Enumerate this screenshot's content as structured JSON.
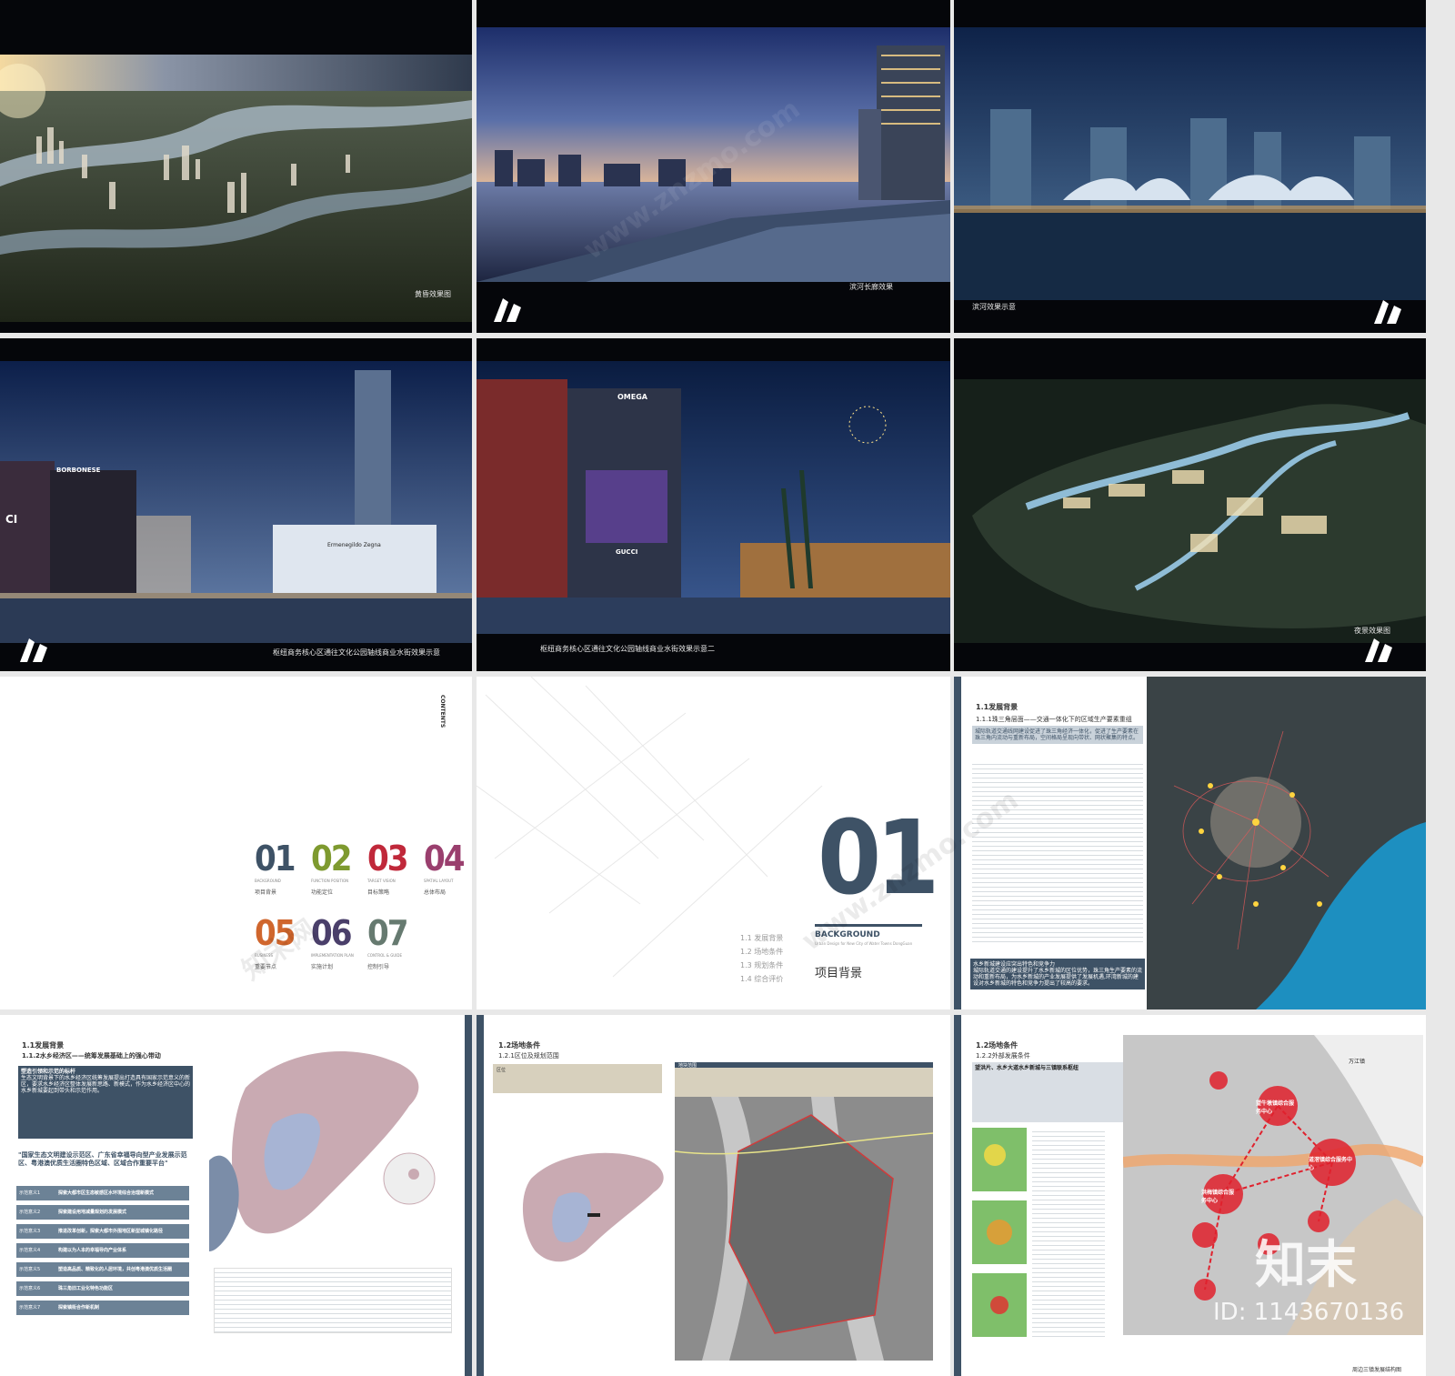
{
  "top_row": [
    {
      "caption": "黄昏效果图"
    },
    {
      "caption": "滨河长廊效果"
    },
    {
      "caption": "滨河效果示意"
    }
  ],
  "mid_row": [
    {
      "caption": "枢纽商务核心区通往文化公园轴线商业水街效果示意"
    },
    {
      "caption": "枢纽商务核心区通往文化公园轴线商业水街效果示意二"
    },
    {
      "caption": "夜景效果图"
    }
  ],
  "signs": {
    "borbonese": "BORBONESE",
    "ci": "CI",
    "zegna": "Ermenegildo Zegna",
    "omega": "OMEGA",
    "gucci": "GUCCI"
  },
  "contents": {
    "vertical_label": "CONTENTS",
    "items": [
      {
        "num": "01",
        "en": "BACKGROUND",
        "cn": "项目背景",
        "color": "#3e5266"
      },
      {
        "num": "02",
        "en": "FUNCTION POSITION",
        "cn": "功能定位",
        "color": "#7e9a2f"
      },
      {
        "num": "03",
        "en": "TARGET VISION",
        "cn": "目标策略",
        "color": "#c0283a"
      },
      {
        "num": "04",
        "en": "SPATIAL LAYOUT",
        "cn": "总体布局",
        "color": "#9a3f6e"
      },
      {
        "num": "05",
        "en": "BUSINESS",
        "cn": "重要节点",
        "color": "#d0662d"
      },
      {
        "num": "06",
        "en": "IMPLEMENTATION PLAN",
        "cn": "实施计划",
        "color": "#4a3f6a"
      },
      {
        "num": "07",
        "en": "CONTROL & GUIDE",
        "cn": "控制引导",
        "color": "#667a70"
      }
    ]
  },
  "chapter": {
    "num": "01",
    "en": "BACKGROUND",
    "en_sub": "Urban Design for New City of Water Towns DongGuan",
    "cn": "项目背景",
    "list": [
      "1.1 发展背景",
      "1.2 场地条件",
      "1.3 规划条件",
      "1.4 综合评价"
    ]
  },
  "page_11": {
    "title": "1.1发展背景",
    "subtitle": "1.1.1珠三角层面——交通一体化下的区域生产要素重组",
    "highlight": "城际轨道交通线网建设促进了珠三角经济一体化，促进了生产要素在珠三角内流动与重新布局，空间格局呈现向带状、网状聚集的特点。",
    "bottom_box": "水乡新城建设应突出特色和竞争力\n城际轨道交通的建设提升了水乡新城的区位优势，珠三角生产要素的流动和重新布局，为水乡新城的产业发展提供了发展机遇,环湾新城的建设对水乡新城的特色和竞争力提出了较高的要求。"
  },
  "page_112": {
    "title": "1.1发展背景",
    "subtitle": "1.1.2水乡经济区——统筹发展基础上的强心带动",
    "box_title": "塑造引领和示范的标杆",
    "box_text": "生态文明背景下的水乡经济区统筹发展提出打造具有国家示范意义的新区，要求水乡经济区整体发展新思路、新模式，作为水乡经济区中心的水乡新城要起到带头和示范作用。",
    "quote": "\"国家生态文明建设示范区、广东省幸福导向型产业发展示范区、粤港澳优质生活圈特色区域、区域合作重要平台\"",
    "rows": [
      {
        "tag": "示范意义1",
        "text": "探索大都市区生态敏感区水环境综合治理新模式"
      },
      {
        "tag": "示范意义2",
        "text": "探索建设用地减量规划的发展模式"
      },
      {
        "tag": "示范意义3",
        "text": "推进改革创新，探索大都市外围地区新型城镇化路径"
      },
      {
        "tag": "示范意义4",
        "text": "构建以为人本的幸福导向产业体系"
      },
      {
        "tag": "示范意义5",
        "text": "塑造高品质、精致化的人居环境，共创粤港澳优质生活圈"
      },
      {
        "tag": "示范意义6",
        "text": "珠三角旧工业化特色功能区"
      },
      {
        "tag": "示范意义7",
        "text": "探索镇街合作新机制"
      }
    ]
  },
  "page_121": {
    "title": "1.2场地条件",
    "subtitle": "1.2.1区位及规划范围",
    "tab": "地块范围",
    "note_label": "区位"
  },
  "page_122": {
    "title": "1.2场地条件",
    "subtitle": "1.2.2外部发展条件",
    "box": "望洪片、水乡大道水乡新城与三镇联系枢纽",
    "places": {
      "wanjiang": "万江镇",
      "wangniudun": "望牛墩镇综合服务中心",
      "daojiao": "道滘镇综合服务中心",
      "hongmei": "洪梅镇综合服务中心"
    },
    "footer": "周边三镇发展结构图"
  },
  "watermarks": {
    "brand": "知末",
    "id": "ID: 1143670136",
    "site": "www.znzmo.com",
    "cn": "知末网"
  }
}
